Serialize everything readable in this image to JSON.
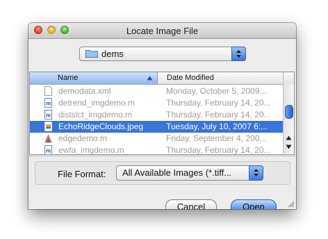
{
  "window": {
    "title": "Locate Image File"
  },
  "folder_popup": {
    "value": "dems",
    "icon": "folder-icon"
  },
  "file_list": {
    "columns": {
      "name": "Name",
      "date": "Date Modified"
    },
    "rows": [
      {
        "name": "demodata.xml",
        "date": "Monday, October 5, 2009...",
        "icon": "document-icon",
        "state": "disabled"
      },
      {
        "name": "detrend_imgdemo.m",
        "date": "Thursday, February 14, 20...",
        "icon": "matlab-m-icon",
        "state": "disabled"
      },
      {
        "name": "distslct_imgdemo.m",
        "date": "Thursday, February 14, 20...",
        "icon": "matlab-m-icon",
        "state": "disabled"
      },
      {
        "name": "EchoRidgeClouds.jpeg",
        "date": "Tuesday, July 10, 2007 6:...",
        "icon": "image-icon",
        "state": "selected"
      },
      {
        "name": "edgedemo.m",
        "date": "Friday, September 4, 200...",
        "icon": "matlab-m-icon",
        "state": "disabled"
      },
      {
        "name": "ewfa_imgdemo.m",
        "date": "Thursday, February 14, 20...",
        "icon": "matlab-m-icon",
        "state": "disabled"
      }
    ]
  },
  "file_format": {
    "label": "File Format:",
    "value": "All Available Images (*.tiff..."
  },
  "buttons": {
    "cancel": "Cancel",
    "open": "Open"
  }
}
